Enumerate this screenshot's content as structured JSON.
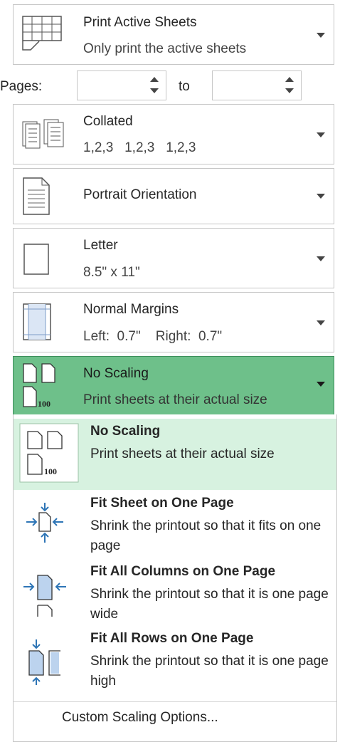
{
  "print_what": {
    "title": "Print Active Sheets",
    "subtitle": "Only print the active sheets",
    "icon": "active-sheets-icon"
  },
  "pages": {
    "label": "Pages:",
    "to_label": "to",
    "from_value": "",
    "to_value": ""
  },
  "collation": {
    "title": "Collated",
    "subtitle": "1,2,3   1,2,3   1,2,3",
    "icon": "collated-pages-icon"
  },
  "orientation": {
    "title": "Portrait Orientation",
    "icon": "portrait-page-icon"
  },
  "paper_size": {
    "title": "Letter",
    "subtitle": "8.5\" x 11\"",
    "icon": "paper-size-icon"
  },
  "margins": {
    "title": "Normal Margins",
    "subtitle": "Left:  0.7\"    Right:  0.7\"",
    "icon": "margins-icon"
  },
  "scaling": {
    "title": "No Scaling",
    "subtitle": "Print sheets at their actual size",
    "icon": "no-scaling-icon",
    "icon_badge": "100",
    "accent_color": "#6ec08a"
  },
  "scaling_menu": {
    "items": [
      {
        "title": "No Scaling",
        "description": "Print sheets at their actual size",
        "icon": "no-scaling-icon",
        "badge": "100",
        "selected": true
      },
      {
        "title": "Fit Sheet on One Page",
        "description": "Shrink the printout so that it fits on one page",
        "icon": "fit-sheet-icon",
        "selected": false
      },
      {
        "title": "Fit All Columns on One Page",
        "description": "Shrink the printout so that it is one page wide",
        "icon": "fit-columns-icon",
        "selected": false
      },
      {
        "title": "Fit All Rows on One Page",
        "description": "Shrink the printout so that it is one page high",
        "icon": "fit-rows-icon",
        "selected": false
      }
    ],
    "custom_label": "Custom Scaling Options..."
  }
}
